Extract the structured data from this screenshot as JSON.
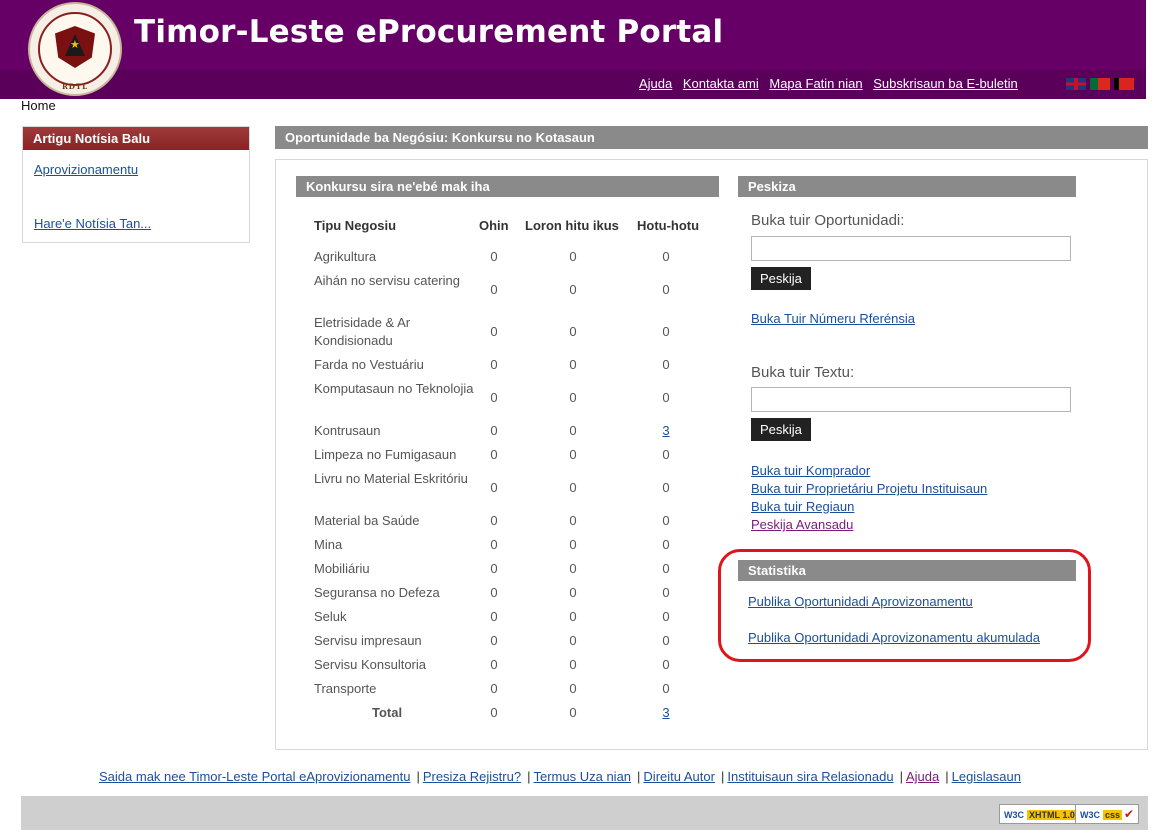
{
  "header": {
    "site_title": "Timor-Leste eProcurement Portal",
    "seal_text": "RDTL",
    "seal_ring_text": "REPÚBLICA DEMOCRÁTICA DE TIMOR-LESTE",
    "top_links": [
      "Ajuda",
      "Kontakta ami",
      "Mapa Fatin nian",
      "Subskrisaun ba E-buletin"
    ],
    "flags": [
      "flag-uk-icon",
      "flag-portugal-icon",
      "flag-timor-leste-icon"
    ]
  },
  "breadcrumb": "Home",
  "left_panel": {
    "title": "Artigu Notísia Balu",
    "link1": "Aprovizionamentu",
    "link2": "Hare'e Notísia Tan..."
  },
  "main": {
    "title": "Oportunidade ba Negósiu: Konkursu no Kotasaun",
    "table_title": "Konkursu sira ne'ebé mak iha",
    "columns": [
      "Tipu Negosiu",
      "Ohin",
      "Loron hitu ikus",
      "Hotu-hotu"
    ],
    "rows": [
      {
        "name": "Agrikultura",
        "today": "0",
        "week": "0",
        "total": "0"
      },
      {
        "name": "Aihán no servisu catering",
        "today": "0",
        "week": "0",
        "total": "0"
      },
      {
        "name": "Eletrisidade & Ar Kondisionadu",
        "today": "0",
        "week": "0",
        "total": "0"
      },
      {
        "name": "Farda no Vestuáriu",
        "today": "0",
        "week": "0",
        "total": "0"
      },
      {
        "name": "Komputasaun no Teknolojia",
        "today": "0",
        "week": "0",
        "total": "0"
      },
      {
        "name": "Kontrusaun",
        "today": "0",
        "week": "0",
        "total": "3"
      },
      {
        "name": "Limpeza no Fumigasaun",
        "today": "0",
        "week": "0",
        "total": "0"
      },
      {
        "name": "Livru no Material Eskritóriu",
        "today": "0",
        "week": "0",
        "total": "0"
      },
      {
        "name": "Material ba Saúde",
        "today": "0",
        "week": "0",
        "total": "0"
      },
      {
        "name": "Mina",
        "today": "0",
        "week": "0",
        "total": "0"
      },
      {
        "name": "Mobiliáriu",
        "today": "0",
        "week": "0",
        "total": "0"
      },
      {
        "name": "Seguransa no Defeza",
        "today": "0",
        "week": "0",
        "total": "0"
      },
      {
        "name": "Seluk",
        "today": "0",
        "week": "0",
        "total": "0"
      },
      {
        "name": "Servisu impresaun",
        "today": "0",
        "week": "0",
        "total": "0"
      },
      {
        "name": "Servisu Konsultoria",
        "today": "0",
        "week": "0",
        "total": "0"
      },
      {
        "name": "Transporte",
        "today": "0",
        "week": "0",
        "total": "0"
      }
    ],
    "total_row": {
      "name": "Total",
      "today": "0",
      "week": "0",
      "total": "3"
    }
  },
  "search": {
    "title": "Peskiza",
    "opportunity_label": "Buka tuir Oportunidadi:",
    "opportunity_value": "",
    "button1": "Peskija",
    "reference_link": "Buka Tuir Númeru Rferénsia",
    "text_label": "Buka tuir Textu:",
    "text_value": "",
    "button2": "Peskija",
    "links": [
      "Buka tuir Komprador",
      "Buka tuir Proprietáriu Projetu Instituisaun",
      "Buka tuir Regiaun",
      "Peskija Avansadu"
    ]
  },
  "statistics": {
    "title": "Statistika",
    "link1": "Publika Oportunidadi Aprovizonamentu",
    "link2": "Publika Oportunidadi Aprovizonamentu akumulada",
    "highlight_color": "#e0141b"
  },
  "footer": {
    "links": [
      "Saida mak nee Timor-Leste Portal eAprovizionamentu",
      "Presiza Rejistru?",
      "Termus Uza nian",
      "Direitu Autor",
      "Instituisaun sira Relasionadu",
      "Ajuda",
      "Legislasaun"
    ],
    "separator": "|",
    "badge1_w3c": "W3C",
    "badge1_tag": "XHTML 1.0",
    "badge2_w3c": "W3C",
    "badge2_tag": "css"
  },
  "colors": {
    "header_purple": "#660066",
    "left_title_red": "#8a2424",
    "section_gray": "#8a8a8a",
    "link_blue": "#1a4f9c",
    "visited_purple": "#7a1a7a"
  }
}
